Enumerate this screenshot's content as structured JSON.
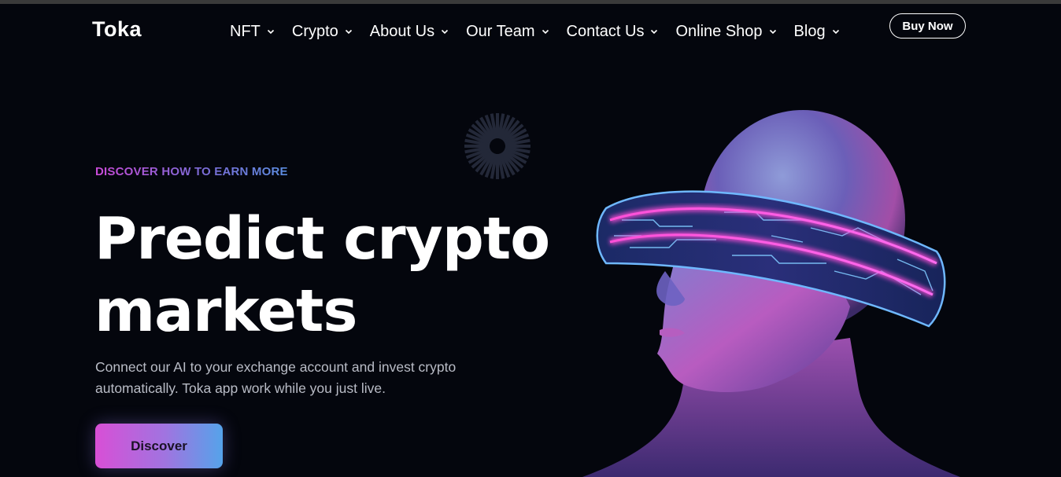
{
  "brand": {
    "name": "Toka"
  },
  "nav": {
    "items": [
      {
        "label": "NFT",
        "icon": "chevron-down-icon"
      },
      {
        "label": "Crypto",
        "icon": "chevron-down-icon"
      },
      {
        "label": "About Us",
        "icon": "chevron-down-icon"
      },
      {
        "label": "Our Team",
        "icon": "chevron-down-icon"
      },
      {
        "label": "Contact Us",
        "icon": "chevron-down-icon"
      },
      {
        "label": "Online Shop",
        "icon": "chevron-down-icon"
      },
      {
        "label": "Blog",
        "icon": "chevron-down-icon"
      }
    ],
    "cta_label": "Buy Now"
  },
  "hero": {
    "eyebrow": "DISCOVER HOW TO EARN MORE",
    "headline_line1": "Predict crypto",
    "headline_line2": "markets",
    "description_line1": "Connect our AI to your exchange account and invest crypto",
    "description_line2": "automatically. Toka app work while you just live.",
    "button_label": "Discover"
  },
  "colors": {
    "background": "#04060d",
    "gradient_pink": "#d84fd6",
    "gradient_blue": "#55a3ea",
    "text_muted": "#b9bcc6"
  }
}
